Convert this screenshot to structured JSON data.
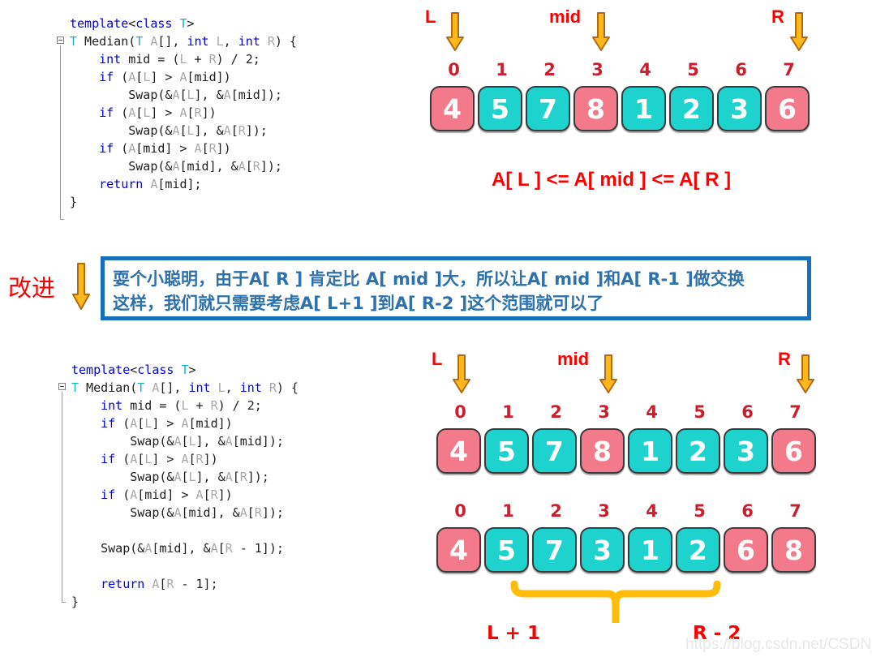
{
  "top_code": {
    "name": "median-of-three-basic",
    "lines": [
      [
        {
          "t": "template",
          "c": "kw"
        },
        {
          "t": "<",
          "c": "pl"
        },
        {
          "t": "class",
          "c": "kw"
        },
        {
          "t": " ",
          "c": "pl"
        },
        {
          "t": "T",
          "c": "ty"
        },
        {
          "t": ">",
          "c": "pl"
        }
      ],
      [
        {
          "t": "T",
          "c": "ty"
        },
        {
          "t": " Median(",
          "c": "pl"
        },
        {
          "t": "T",
          "c": "ty"
        },
        {
          "t": " ",
          "c": "pl"
        },
        {
          "t": "A",
          "c": "id"
        },
        {
          "t": "[], ",
          "c": "pl"
        },
        {
          "t": "int",
          "c": "kw"
        },
        {
          "t": " ",
          "c": "pl"
        },
        {
          "t": "L",
          "c": "id"
        },
        {
          "t": ", ",
          "c": "pl"
        },
        {
          "t": "int",
          "c": "kw"
        },
        {
          "t": " ",
          "c": "pl"
        },
        {
          "t": "R",
          "c": "id"
        },
        {
          "t": ") {",
          "c": "pl"
        }
      ],
      [
        {
          "t": "    ",
          "c": "pl"
        },
        {
          "t": "int",
          "c": "kw"
        },
        {
          "t": " mid = (",
          "c": "pl"
        },
        {
          "t": "L",
          "c": "id"
        },
        {
          "t": " + ",
          "c": "pl"
        },
        {
          "t": "R",
          "c": "id"
        },
        {
          "t": ") / 2;",
          "c": "pl"
        }
      ],
      [
        {
          "t": "    ",
          "c": "pl"
        },
        {
          "t": "if",
          "c": "kw"
        },
        {
          "t": " (",
          "c": "pl"
        },
        {
          "t": "A",
          "c": "id"
        },
        {
          "t": "[",
          "c": "pl"
        },
        {
          "t": "L",
          "c": "id"
        },
        {
          "t": "] > ",
          "c": "pl"
        },
        {
          "t": "A",
          "c": "id"
        },
        {
          "t": "[mid])",
          "c": "pl"
        }
      ],
      [
        {
          "t": "        Swap(&",
          "c": "pl"
        },
        {
          "t": "A",
          "c": "id"
        },
        {
          "t": "[",
          "c": "pl"
        },
        {
          "t": "L",
          "c": "id"
        },
        {
          "t": "], &",
          "c": "pl"
        },
        {
          "t": "A",
          "c": "id"
        },
        {
          "t": "[mid]);",
          "c": "pl"
        }
      ],
      [
        {
          "t": "    ",
          "c": "pl"
        },
        {
          "t": "if",
          "c": "kw"
        },
        {
          "t": " (",
          "c": "pl"
        },
        {
          "t": "A",
          "c": "id"
        },
        {
          "t": "[",
          "c": "pl"
        },
        {
          "t": "L",
          "c": "id"
        },
        {
          "t": "] > ",
          "c": "pl"
        },
        {
          "t": "A",
          "c": "id"
        },
        {
          "t": "[",
          "c": "pl"
        },
        {
          "t": "R",
          "c": "id"
        },
        {
          "t": "])",
          "c": "pl"
        }
      ],
      [
        {
          "t": "        Swap(&",
          "c": "pl"
        },
        {
          "t": "A",
          "c": "id"
        },
        {
          "t": "[",
          "c": "pl"
        },
        {
          "t": "L",
          "c": "id"
        },
        {
          "t": "], &",
          "c": "pl"
        },
        {
          "t": "A",
          "c": "id"
        },
        {
          "t": "[",
          "c": "pl"
        },
        {
          "t": "R",
          "c": "id"
        },
        {
          "t": "]);",
          "c": "pl"
        }
      ],
      [
        {
          "t": "    ",
          "c": "pl"
        },
        {
          "t": "if",
          "c": "kw"
        },
        {
          "t": " (",
          "c": "pl"
        },
        {
          "t": "A",
          "c": "id"
        },
        {
          "t": "[mid] > ",
          "c": "pl"
        },
        {
          "t": "A",
          "c": "id"
        },
        {
          "t": "[",
          "c": "pl"
        },
        {
          "t": "R",
          "c": "id"
        },
        {
          "t": "])",
          "c": "pl"
        }
      ],
      [
        {
          "t": "        Swap(&",
          "c": "pl"
        },
        {
          "t": "A",
          "c": "id"
        },
        {
          "t": "[mid], &",
          "c": "pl"
        },
        {
          "t": "A",
          "c": "id"
        },
        {
          "t": "[",
          "c": "pl"
        },
        {
          "t": "R",
          "c": "id"
        },
        {
          "t": "]);",
          "c": "pl"
        }
      ],
      [
        {
          "t": "    ",
          "c": "pl"
        },
        {
          "t": "return",
          "c": "kw"
        },
        {
          "t": " ",
          "c": "pl"
        },
        {
          "t": "A",
          "c": "id"
        },
        {
          "t": "[mid];",
          "c": "pl"
        }
      ],
      [
        {
          "t": "}",
          "c": "pl"
        }
      ]
    ]
  },
  "bottom_code": {
    "name": "median-of-three-improved",
    "lines": [
      [
        {
          "t": "template",
          "c": "kw"
        },
        {
          "t": "<",
          "c": "pl"
        },
        {
          "t": "class",
          "c": "kw"
        },
        {
          "t": " ",
          "c": "pl"
        },
        {
          "t": "T",
          "c": "ty"
        },
        {
          "t": ">",
          "c": "pl"
        }
      ],
      [
        {
          "t": "T",
          "c": "ty"
        },
        {
          "t": " Median(",
          "c": "pl"
        },
        {
          "t": "T",
          "c": "ty"
        },
        {
          "t": " ",
          "c": "pl"
        },
        {
          "t": "A",
          "c": "id"
        },
        {
          "t": "[], ",
          "c": "pl"
        },
        {
          "t": "int",
          "c": "kw"
        },
        {
          "t": " ",
          "c": "pl"
        },
        {
          "t": "L",
          "c": "id"
        },
        {
          "t": ", ",
          "c": "pl"
        },
        {
          "t": "int",
          "c": "kw"
        },
        {
          "t": " ",
          "c": "pl"
        },
        {
          "t": "R",
          "c": "id"
        },
        {
          "t": ") {",
          "c": "pl"
        }
      ],
      [
        {
          "t": "    ",
          "c": "pl"
        },
        {
          "t": "int",
          "c": "kw"
        },
        {
          "t": " mid = (",
          "c": "pl"
        },
        {
          "t": "L",
          "c": "id"
        },
        {
          "t": " + ",
          "c": "pl"
        },
        {
          "t": "R",
          "c": "id"
        },
        {
          "t": ") / 2;",
          "c": "pl"
        }
      ],
      [
        {
          "t": "    ",
          "c": "pl"
        },
        {
          "t": "if",
          "c": "kw"
        },
        {
          "t": " (",
          "c": "pl"
        },
        {
          "t": "A",
          "c": "id"
        },
        {
          "t": "[",
          "c": "pl"
        },
        {
          "t": "L",
          "c": "id"
        },
        {
          "t": "] > ",
          "c": "pl"
        },
        {
          "t": "A",
          "c": "id"
        },
        {
          "t": "[mid])",
          "c": "pl"
        }
      ],
      [
        {
          "t": "        Swap(&",
          "c": "pl"
        },
        {
          "t": "A",
          "c": "id"
        },
        {
          "t": "[",
          "c": "pl"
        },
        {
          "t": "L",
          "c": "id"
        },
        {
          "t": "], &",
          "c": "pl"
        },
        {
          "t": "A",
          "c": "id"
        },
        {
          "t": "[mid]);",
          "c": "pl"
        }
      ],
      [
        {
          "t": "    ",
          "c": "pl"
        },
        {
          "t": "if",
          "c": "kw"
        },
        {
          "t": " (",
          "c": "pl"
        },
        {
          "t": "A",
          "c": "id"
        },
        {
          "t": "[",
          "c": "pl"
        },
        {
          "t": "L",
          "c": "id"
        },
        {
          "t": "] > ",
          "c": "pl"
        },
        {
          "t": "A",
          "c": "id"
        },
        {
          "t": "[",
          "c": "pl"
        },
        {
          "t": "R",
          "c": "id"
        },
        {
          "t": "])",
          "c": "pl"
        }
      ],
      [
        {
          "t": "        Swap(&",
          "c": "pl"
        },
        {
          "t": "A",
          "c": "id"
        },
        {
          "t": "[",
          "c": "pl"
        },
        {
          "t": "L",
          "c": "id"
        },
        {
          "t": "], &",
          "c": "pl"
        },
        {
          "t": "A",
          "c": "id"
        },
        {
          "t": "[",
          "c": "pl"
        },
        {
          "t": "R",
          "c": "id"
        },
        {
          "t": "]);",
          "c": "pl"
        }
      ],
      [
        {
          "t": "    ",
          "c": "pl"
        },
        {
          "t": "if",
          "c": "kw"
        },
        {
          "t": " (",
          "c": "pl"
        },
        {
          "t": "A",
          "c": "id"
        },
        {
          "t": "[mid] > ",
          "c": "pl"
        },
        {
          "t": "A",
          "c": "id"
        },
        {
          "t": "[",
          "c": "pl"
        },
        {
          "t": "R",
          "c": "id"
        },
        {
          "t": "])",
          "c": "pl"
        }
      ],
      [
        {
          "t": "        Swap(&",
          "c": "pl"
        },
        {
          "t": "A",
          "c": "id"
        },
        {
          "t": "[mid], &",
          "c": "pl"
        },
        {
          "t": "A",
          "c": "id"
        },
        {
          "t": "[",
          "c": "pl"
        },
        {
          "t": "R",
          "c": "id"
        },
        {
          "t": "]);",
          "c": "pl"
        }
      ],
      [],
      [
        {
          "t": "    Swap(&",
          "c": "pl"
        },
        {
          "t": "A",
          "c": "id"
        },
        {
          "t": "[mid], &",
          "c": "pl"
        },
        {
          "t": "A",
          "c": "id"
        },
        {
          "t": "[",
          "c": "pl"
        },
        {
          "t": "R",
          "c": "id"
        },
        {
          "t": " - 1]);",
          "c": "pl"
        }
      ],
      [],
      [
        {
          "t": "    ",
          "c": "pl"
        },
        {
          "t": "return",
          "c": "kw"
        },
        {
          "t": " ",
          "c": "pl"
        },
        {
          "t": "A",
          "c": "id"
        },
        {
          "t": "[",
          "c": "pl"
        },
        {
          "t": "R",
          "c": "id"
        },
        {
          "t": " - 1];",
          "c": "pl"
        }
      ],
      [
        {
          "t": "}",
          "c": "pl"
        }
      ]
    ]
  },
  "colors": {
    "pink": "#f27a8b",
    "teal": "#1ed2ce",
    "index_red": "#c8202e",
    "label_red": "#ff0000",
    "arrow_amber": "#ffb819",
    "arrow_outline": "#b06a12",
    "brace_amber": "#ffbc0b",
    "note_border": "#1670bd",
    "note_text": "#2d71ad",
    "note_tag_red": "#ff0000"
  },
  "diagram_top": {
    "indices": [
      "0",
      "1",
      "2",
      "3",
      "4",
      "5",
      "6",
      "7"
    ],
    "cells": [
      {
        "value": "4",
        "color": "pink"
      },
      {
        "value": "5",
        "color": "teal"
      },
      {
        "value": "7",
        "color": "teal"
      },
      {
        "value": "8",
        "color": "pink"
      },
      {
        "value": "1",
        "color": "teal"
      },
      {
        "value": "2",
        "color": "teal"
      },
      {
        "value": "3",
        "color": "teal"
      },
      {
        "value": "6",
        "color": "pink"
      }
    ],
    "pointers": [
      {
        "label": "L",
        "index": 0
      },
      {
        "label": "mid",
        "index": 3
      },
      {
        "label": "R",
        "index": 7
      }
    ],
    "caption": "A[ L ] <= A[ mid ] <= A[ R ]"
  },
  "note": {
    "tag": "改进",
    "line1": "耍个小聪明，由于A[ R ] 肯定比 A[ mid ]大，所以让A[ mid ]和A[ R-1 ]做交换",
    "line2": "这样，我们就只需要考虑A[ L+1 ]到A[ R-2 ]这个范围就可以了"
  },
  "diagram_mid": {
    "indices": [
      "0",
      "1",
      "2",
      "3",
      "4",
      "5",
      "6",
      "7"
    ],
    "cells": [
      {
        "value": "4",
        "color": "pink"
      },
      {
        "value": "5",
        "color": "teal"
      },
      {
        "value": "7",
        "color": "teal"
      },
      {
        "value": "8",
        "color": "pink"
      },
      {
        "value": "1",
        "color": "teal"
      },
      {
        "value": "2",
        "color": "teal"
      },
      {
        "value": "3",
        "color": "teal"
      },
      {
        "value": "6",
        "color": "pink"
      }
    ],
    "pointers": [
      {
        "label": "L",
        "index": 0
      },
      {
        "label": "mid",
        "index": 3
      },
      {
        "label": "R",
        "index": 7
      }
    ]
  },
  "diagram_bottom": {
    "indices": [
      "0",
      "1",
      "2",
      "3",
      "4",
      "5",
      "6",
      "7"
    ],
    "cells": [
      {
        "value": "4",
        "color": "pink"
      },
      {
        "value": "5",
        "color": "teal"
      },
      {
        "value": "7",
        "color": "teal"
      },
      {
        "value": "3",
        "color": "teal"
      },
      {
        "value": "1",
        "color": "teal"
      },
      {
        "value": "2",
        "color": "teal"
      },
      {
        "value": "6",
        "color": "pink"
      },
      {
        "value": "8",
        "color": "pink"
      }
    ],
    "brace_left_label": "L + 1",
    "brace_right_label": "R - 2"
  },
  "watermark": "https://blog.csdn.net/CSDN_dzh"
}
